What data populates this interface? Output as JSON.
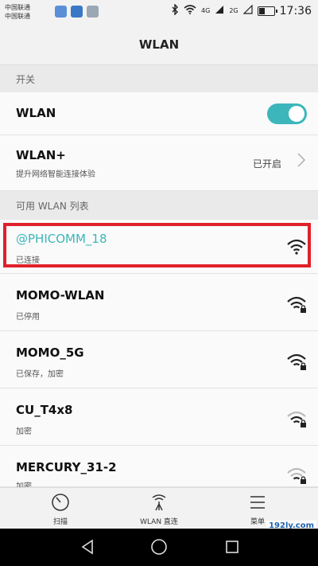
{
  "status_bar": {
    "carrier_lines": [
      "中国联通",
      "中国联通"
    ],
    "network_4g": "4G",
    "network_2g": "2G",
    "time": "17:36"
  },
  "app_bar": {
    "title": "WLAN"
  },
  "sections": {
    "switch_header": "开关",
    "available_header": "可用 WLAN 列表"
  },
  "wlan_toggle": {
    "label": "WLAN",
    "state": "on"
  },
  "wlan_plus": {
    "label": "WLAN+",
    "subtitle": "提升网络智能连接体验",
    "status": "已开启"
  },
  "networks": [
    {
      "ssid": "@PHICOMM_18",
      "status": "已连接",
      "highlighted": true,
      "ssid_color": "#3cb6bb",
      "locked": false
    },
    {
      "ssid": "MOMO-WLAN",
      "status": "已停用",
      "highlighted": false,
      "locked": true
    },
    {
      "ssid": "MOMO_5G",
      "status": "已保存，加密",
      "highlighted": false,
      "locked": true
    },
    {
      "ssid": "CU_T4x8",
      "status": "加密",
      "highlighted": false,
      "locked": true
    },
    {
      "ssid": "MERCURY_31-2",
      "status": "加密",
      "highlighted": false,
      "locked": true
    }
  ],
  "bottom_bar": [
    {
      "label": "扫描",
      "icon": "scan-icon"
    },
    {
      "label": "WLAN 直连",
      "icon": "wlan-direct-icon"
    },
    {
      "label": "菜单",
      "icon": "menu-icon"
    }
  ],
  "watermark": "192ly.com",
  "colors": {
    "accent": "#3cb6bb",
    "highlight_border": "#e0202a"
  }
}
